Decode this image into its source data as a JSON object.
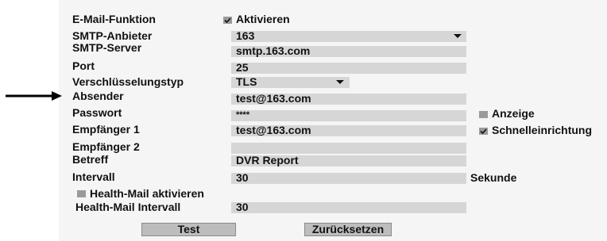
{
  "labels": {
    "email_function": "E-Mail-Funktion",
    "smtp_provider": "SMTP-Anbieter",
    "smtp_server": "SMTP-Server",
    "port": "Port",
    "encryption": "Verschlüsselungstyp",
    "sender": "Absender",
    "password": "Passwort",
    "recipient1": "Empfänger 1",
    "recipient2": "Empfänger 2",
    "subject": "Betreff",
    "interval": "Intervall",
    "health_mail_enable": "Health-Mail aktivieren",
    "health_mail_interval": "Health-Mail Intervall"
  },
  "values": {
    "activate": "Aktivieren",
    "smtp_provider": "163",
    "smtp_server": "smtp.163.com",
    "port": "25",
    "encryption": "TLS",
    "sender": "test@163.com",
    "password": "****",
    "recipient1": "test@163.com",
    "recipient2": "",
    "subject": "DVR Report",
    "interval": "30",
    "interval_unit": "Sekunde",
    "health_mail_interval": "30"
  },
  "options": {
    "show_password": "Anzeige",
    "quick_setup": "Schnelleinrichtung"
  },
  "checks": {
    "activate": true,
    "show_password": false,
    "quick_setup": true,
    "health_mail": false
  },
  "buttons": {
    "test": "Test",
    "reset": "Zurücksetzen"
  }
}
